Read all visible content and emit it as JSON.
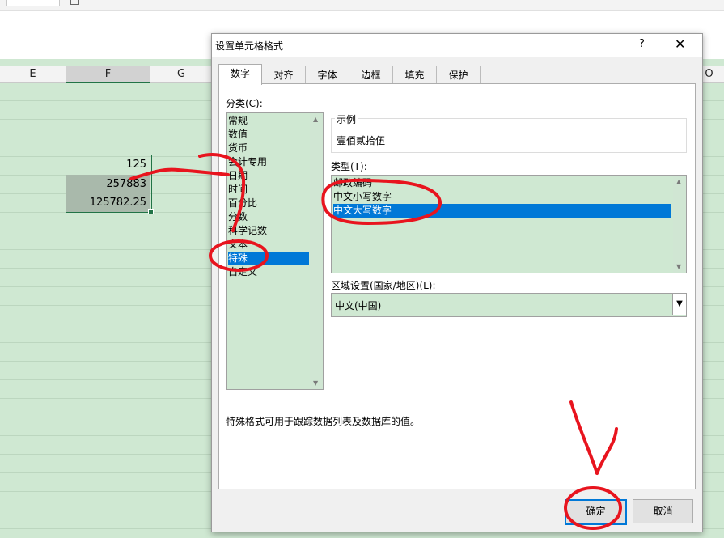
{
  "spreadsheet": {
    "columns": [
      {
        "label": "E",
        "selected": false
      },
      {
        "label": "F",
        "selected": true
      },
      {
        "label": "G",
        "selected": false
      },
      {
        "label": "O",
        "selected": false
      }
    ],
    "cells": [
      "125",
      "257883",
      "125782.25"
    ]
  },
  "dialog": {
    "title": "设置单元格格式",
    "help": "?",
    "close": "✕",
    "tabs": [
      "数字",
      "对齐",
      "字体",
      "边框",
      "填充",
      "保护"
    ],
    "active_tab": "数字",
    "category_label": "分类(C):",
    "categories": [
      "常规",
      "数值",
      "货币",
      "会计专用",
      "日期",
      "时间",
      "百分比",
      "分数",
      "科学记数",
      "文本",
      "特殊",
      "自定义"
    ],
    "selected_category": "特殊",
    "sample_label": "示例",
    "sample_value": "壹佰贰拾伍",
    "type_label": "类型(T):",
    "types": [
      "邮政编码",
      "中文小写数字",
      "中文大写数字"
    ],
    "selected_type": "中文大写数字",
    "locale_label": "区域设置(国家/地区)(L):",
    "locale_value": "中文(中国)",
    "description": "特殊格式可用于跟踪数据列表及数据库的值。",
    "ok_label": "确定",
    "cancel_label": "取消"
  },
  "colors": {
    "accent": "#0078d7",
    "annotation": "#e8141e",
    "sheet_background": "#cfe8d2"
  }
}
